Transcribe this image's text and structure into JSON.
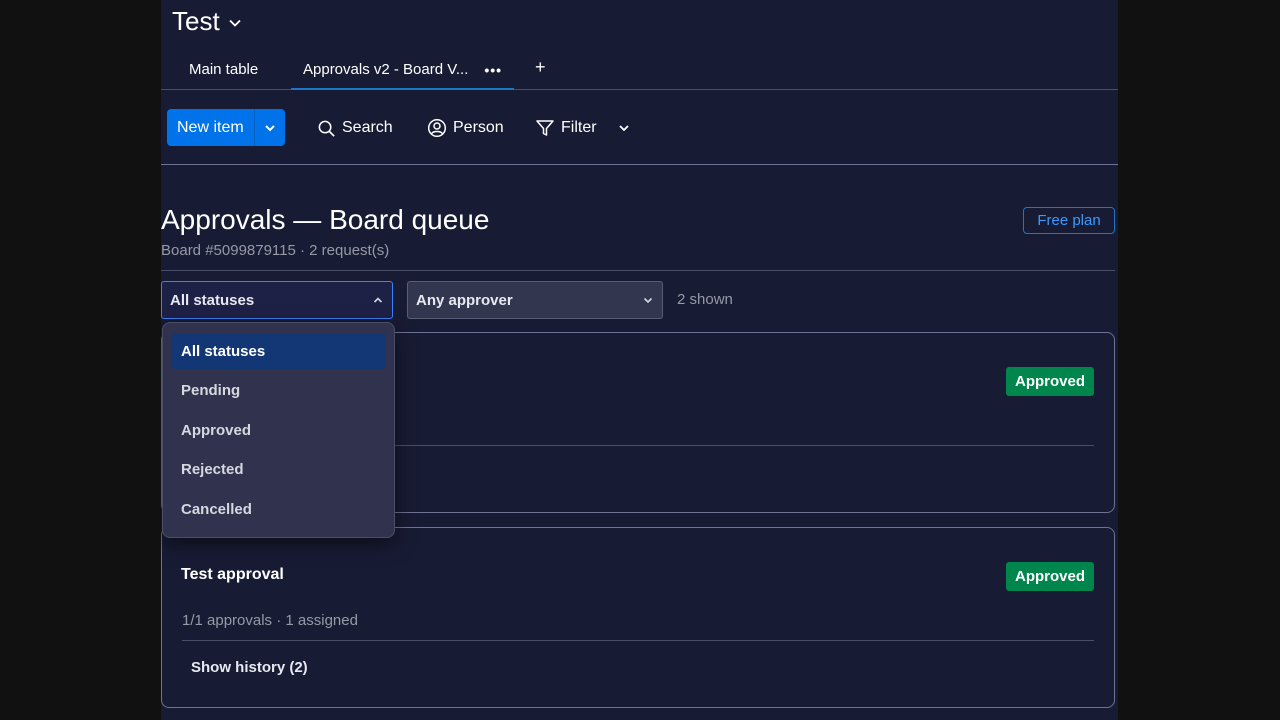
{
  "board": {
    "title": "Test"
  },
  "tabs": [
    {
      "label": "Main table"
    },
    {
      "label": "Approvals v2 - Board V...",
      "more": "•••"
    }
  ],
  "tab_add": "+",
  "toolbar": {
    "new_item": "New item",
    "search": "Search",
    "person": "Person",
    "filter": "Filter"
  },
  "header": {
    "title": "Approvals — Board queue",
    "subtitle": "Board #5099879115 · 2 request(s)",
    "plan_badge": "Free plan"
  },
  "filters": {
    "status_value": "All statuses",
    "approver_value": "Any approver",
    "shown_count": "2 shown"
  },
  "status_options": [
    "All statuses",
    "Pending",
    "Approved",
    "Rejected",
    "Cancelled"
  ],
  "cards": [
    {
      "title": "",
      "status": "Approved",
      "meta": "",
      "history": ""
    },
    {
      "title": "Test approval",
      "status": "Approved",
      "meta": "1/1 approvals · 1 assigned",
      "history": "Show history (2)"
    }
  ],
  "colors": {
    "background": "#181b34",
    "primary": "#0073ea",
    "approved": "#00854d",
    "selected_option": "#133774"
  }
}
